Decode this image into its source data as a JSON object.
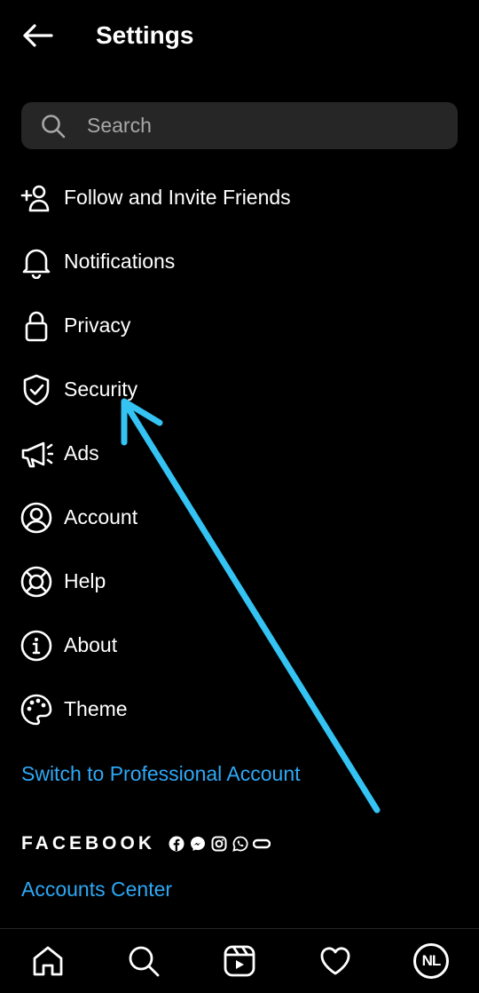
{
  "header": {
    "title": "Settings"
  },
  "search": {
    "placeholder": "Search"
  },
  "menu": [
    {
      "label": "Follow and Invite Friends",
      "icon": "add-person-icon"
    },
    {
      "label": "Notifications",
      "icon": "bell-icon"
    },
    {
      "label": "Privacy",
      "icon": "lock-icon"
    },
    {
      "label": "Security",
      "icon": "shield-check-icon"
    },
    {
      "label": "Ads",
      "icon": "megaphone-icon"
    },
    {
      "label": "Account",
      "icon": "account-circle-icon"
    },
    {
      "label": "Help",
      "icon": "lifebuoy-icon"
    },
    {
      "label": "About",
      "icon": "info-icon"
    },
    {
      "label": "Theme",
      "icon": "palette-icon"
    }
  ],
  "links": {
    "switch_professional": "Switch to Professional Account",
    "accounts_center": "Accounts Center"
  },
  "facebook": {
    "wordmark": "FACEBOOK",
    "apps": [
      "facebook-icon",
      "messenger-icon",
      "instagram-icon",
      "whatsapp-icon",
      "portal-icon"
    ]
  },
  "bottom_nav": {
    "tabs": [
      "home-icon",
      "search-icon",
      "reels-icon",
      "heart-icon",
      "profile-avatar"
    ],
    "avatar_initials": "NL"
  },
  "colors": {
    "background": "#000000",
    "search_bg": "#262626",
    "link": "#2ea8f5",
    "annotation_arrow": "#34c3f2"
  }
}
